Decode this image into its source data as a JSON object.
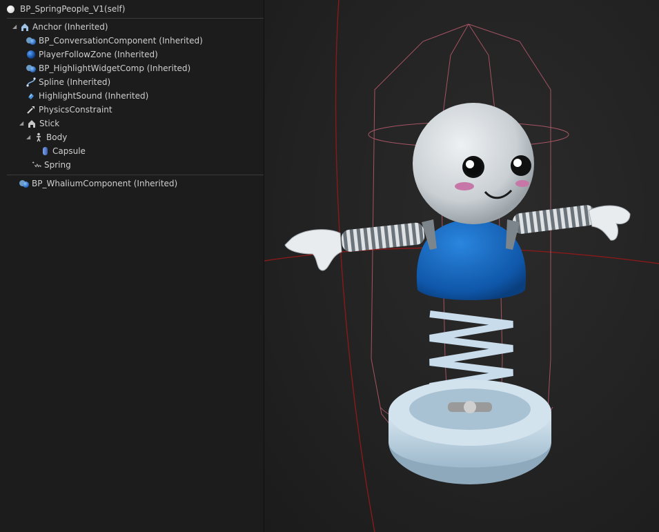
{
  "components_panel": {
    "self_item": {
      "label": "BP_SpringPeople_V1(self)",
      "icon": "white-sphere-icon"
    },
    "tree": [
      {
        "label": "Anchor (Inherited)",
        "icon": "anchor-icon",
        "expanded": true
      },
      {
        "label": "BP_ConversationComponent (Inherited)",
        "icon": "actor-component-icon"
      },
      {
        "label": "PlayerFollowZone (Inherited)",
        "icon": "sphere-collision-icon"
      },
      {
        "label": "BP_HighlightWidgetComp (Inherited)",
        "icon": "widget-component-icon"
      },
      {
        "label": "Spline (Inherited)",
        "icon": "spline-icon"
      },
      {
        "label": "HighlightSound (Inherited)",
        "icon": "audio-icon"
      },
      {
        "label": "PhysicsConstraint",
        "icon": "physics-constraint-icon"
      },
      {
        "label": "Stick",
        "icon": "scene-component-icon",
        "expanded": true
      },
      {
        "label": "Body",
        "icon": "skeletal-mesh-icon",
        "expanded": true
      },
      {
        "label": "Capsule",
        "icon": "capsule-icon"
      },
      {
        "label": "Spring",
        "icon": "spring-arm-icon"
      }
    ],
    "non_scene_components": [
      {
        "label": "BP_WhaliumComponent (Inherited)",
        "icon": "actor-component-icon"
      }
    ]
  },
  "viewport": {
    "subject": "spring-character-preview",
    "colors": {
      "background": "#222222",
      "head": "#d9dde0",
      "torso": "#1565c0",
      "spring": "#c8dcec",
      "base": "#c2d8e6",
      "bounds_wireframe": "#b45a6a",
      "axis_line": "#8a1a1a"
    }
  }
}
